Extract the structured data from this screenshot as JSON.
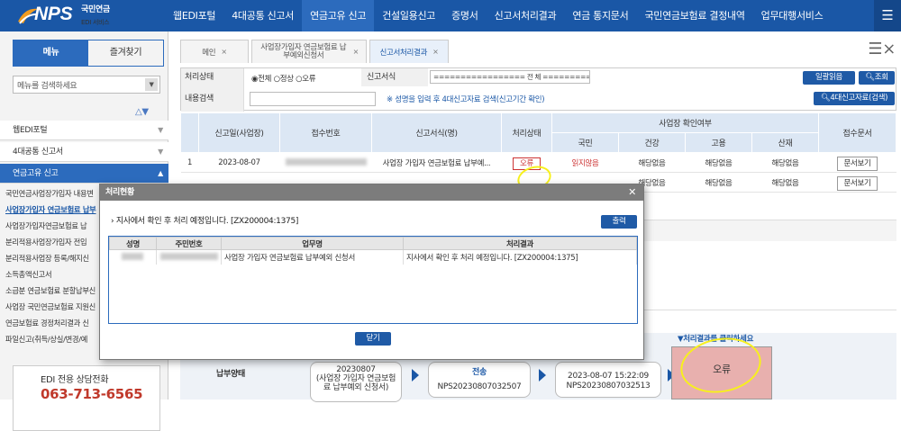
{
  "header": {
    "logo": "NPS",
    "logo_ko": "국민연금",
    "logo_sub": "EDI 서비스",
    "nav": [
      "웹EDI포털",
      "4대공통 신고서",
      "연금고유 신고",
      "건설일용신고",
      "증명서",
      "신고서처리결과",
      "연금 통지문서",
      "국민연금보험료 결정내역",
      "업무대행서비스"
    ],
    "nav_active_index": 2
  },
  "sidebar": {
    "tabs": [
      "메뉴",
      "즐겨찾기"
    ],
    "search_placeholder": "메뉴를 검색하세요",
    "sections": [
      "웹EDI포털",
      "4대공통 신고서",
      "연금고유 신고"
    ],
    "subitems": [
      "국민연금사업장가입자 내용변",
      "사업장가입자 연금보험료 납부",
      "사업장가입자연금보험료 납",
      "분리적용사업장가입자 전입",
      "분리적용사업장 등록/해지신",
      "소득총액신고서",
      "소급분 연금보험료 분할납부신",
      "사업장 국민연금보험료 지원신",
      "연금보험료 경정처리결과 신",
      "파일신고(취득/상실/변경/예"
    ],
    "subitem_active_index": 1,
    "help_title": "EDI 전용 상담전화",
    "help_number": "063-713-6565"
  },
  "tabs": [
    {
      "label": "메인"
    },
    {
      "label": "사업장가입자 연금보험료 납부예외신청서"
    },
    {
      "label": "신고서처리결과"
    }
  ],
  "filter": {
    "status_label": "처리상태",
    "status_options": [
      "전체",
      "정상",
      "오류"
    ],
    "form_label": "신고서식",
    "form_value": "================= 전 체 ==========",
    "content_label": "내용검색",
    "note": "※ 성명을 입력 후 4대신고자료 검색(신고기간 확인)",
    "btn_bulk": "일괄읽음",
    "btn_search": "조회",
    "btn_4": "4대신고자료(검색)"
  },
  "grid": {
    "headers": {
      "date": "신고일(사업장)",
      "receipt": "접수번호",
      "form": "신고서식(명)",
      "status": "처리상태",
      "confirm": "사업장 확인여부",
      "sub": [
        "국민",
        "건강",
        "고용",
        "산재"
      ],
      "doc": "접수문서"
    },
    "rows": [
      {
        "no": "1",
        "date": "2023-08-07",
        "form": "사업장 가입자 연금보험료 납부예...",
        "status": "오류",
        "k1": "읽지않음",
        "k2": "해당없음",
        "k3": "해당없음",
        "k4": "해당없음",
        "doc": "문서보기"
      },
      {
        "k2": "해당없음",
        "k3": "해당없음",
        "k4": "해당없음",
        "doc": "문서보기"
      }
    ]
  },
  "flow": {
    "hint": "▼처리결과를 클릭하세요",
    "left_label": "납부양태",
    "s1a": "20230807",
    "s1b": "(사업장 가입자 연금보험",
    "s1c": "료 납부예외 신청서)",
    "s2a": "전송",
    "s2b": "NPS20230807032507",
    "s3b": "2023-08-07 15:22:09",
    "s3c": "NPS20230807032513",
    "err": "오류"
  },
  "modal": {
    "title": "처리현황",
    "message": "› 지사에서 확인 후 처리 예정입니다. [ZX200004:1375]",
    "print": "출력",
    "close": "닫기",
    "headers": [
      "성명",
      "주민번호",
      "업무명",
      "처리결과"
    ],
    "row": {
      "task": "사업장 가입자 연금보험료 납부예외 신청서",
      "result": "지사에서 확인 후 처리 예정입니다. [ZX200004:1375]"
    }
  }
}
